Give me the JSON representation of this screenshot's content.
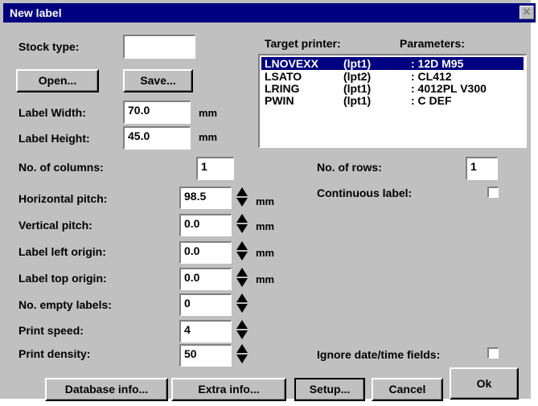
{
  "window": {
    "title": "New label",
    "close_glyph": "✕"
  },
  "stock": {
    "label": "Stock type:",
    "value": ""
  },
  "buttons": {
    "open": "Open...",
    "save": "Save...",
    "database_info": "Database info...",
    "extra_info": "Extra info...",
    "setup": "Setup...",
    "cancel": "Cancel",
    "ok": "Ok"
  },
  "label_size": {
    "width_label": "Label Width:",
    "width_value": "70.0",
    "width_unit": "mm",
    "height_label": "Label Height:",
    "height_value": "45.0",
    "height_unit": "mm"
  },
  "printers": {
    "target_header": "Target printer:",
    "params_header": "Parameters:",
    "items": [
      {
        "name": "LNOVEXX",
        "port": "(lpt1)",
        "params": ": 12D M95",
        "selected": true
      },
      {
        "name": "LSATO",
        "port": "(lpt2)",
        "params": ": CL412",
        "selected": false
      },
      {
        "name": "LRING",
        "port": "(lpt1)",
        "params": ": 4012PL V300",
        "selected": false
      },
      {
        "name": "PWIN",
        "port": "(lpt1)",
        "params": ": C DEF",
        "selected": false
      }
    ]
  },
  "layout_fields": {
    "columns_label": "No. of columns:",
    "columns_value": "1",
    "rows_label": "No. of rows:",
    "rows_value": "1",
    "continuous_label": "Continuous label:",
    "continuous_checked": false,
    "hpitch_label": "Horizontal pitch:",
    "hpitch_value": "98.5",
    "hpitch_unit": "mm",
    "vpitch_label": "Vertical pitch:",
    "vpitch_value": "0.0",
    "vpitch_unit": "mm",
    "left_origin_label": "Label left origin:",
    "left_origin_value": "0.0",
    "left_origin_unit": "mm",
    "top_origin_label": "Label top origin:",
    "top_origin_value": "0.0",
    "top_origin_unit": "mm",
    "empty_labels_label": "No. empty labels:",
    "empty_labels_value": "0",
    "speed_label": "Print speed:",
    "speed_value": "4",
    "density_label": "Print density:",
    "density_value": "50",
    "ignore_date_label": "Ignore date/time fields:",
    "ignore_date_checked": false
  }
}
